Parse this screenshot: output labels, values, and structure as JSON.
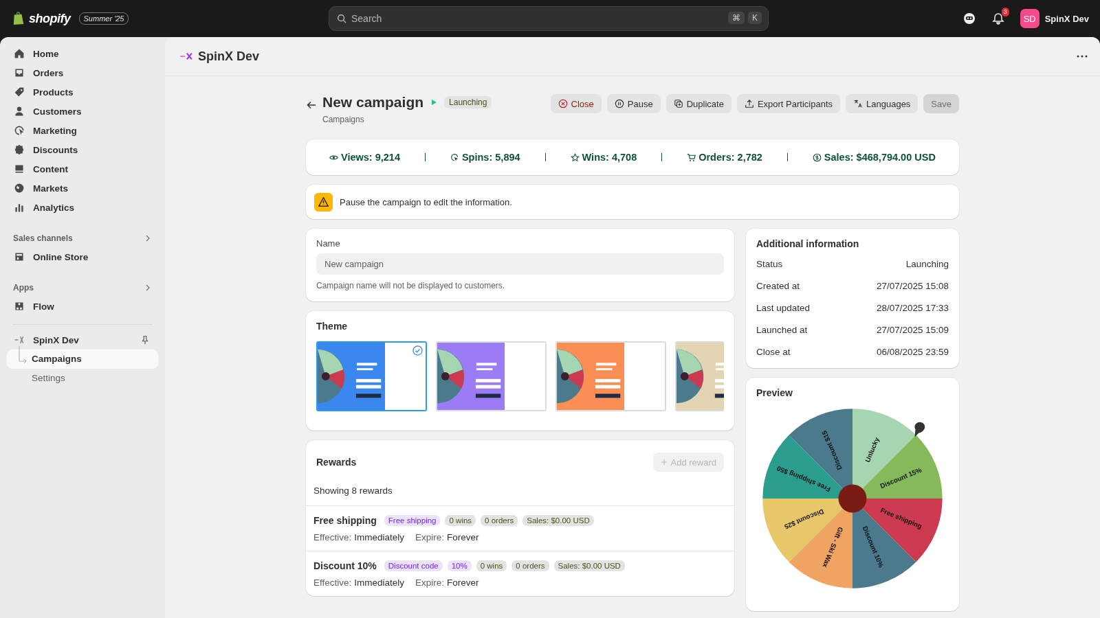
{
  "topbar": {
    "logo": "shopify",
    "edition": "Summer '25",
    "search": {
      "placeholder": "Search",
      "keys": [
        "⌘",
        "K"
      ]
    },
    "notifications": "3",
    "avatar": "SD",
    "store": "SpinX Dev"
  },
  "sidebar": {
    "items": [
      {
        "label": "Home",
        "selected": false
      },
      {
        "label": "Orders",
        "selected": false
      },
      {
        "label": "Products",
        "selected": false
      },
      {
        "label": "Customers",
        "selected": false
      },
      {
        "label": "Marketing",
        "selected": false
      },
      {
        "label": "Discounts",
        "selected": false
      },
      {
        "label": "Content",
        "selected": false
      },
      {
        "label": "Markets",
        "selected": false
      },
      {
        "label": "Analytics",
        "selected": false
      }
    ],
    "sections": [
      {
        "title": "Sales channels",
        "items": [
          {
            "label": "Online Store",
            "selected": false
          }
        ]
      },
      {
        "title": "Apps",
        "items": [
          {
            "label": "Flow",
            "selected": false
          }
        ]
      }
    ],
    "app": {
      "label": "SpinX Dev",
      "children": [
        {
          "label": "Campaigns",
          "selected": true
        },
        {
          "label": "Settings",
          "selected": false
        }
      ]
    }
  },
  "app_header": {
    "title": "SpinX Dev"
  },
  "page": {
    "title": "New campaign",
    "status": "Launching",
    "breadcrumb": "Campaigns",
    "actions": [
      {
        "label": "Close",
        "kind": "critical",
        "disabled": false
      },
      {
        "label": "Pause",
        "kind": "plain",
        "disabled": false
      },
      {
        "label": "Duplicate",
        "kind": "plain",
        "disabled": false
      },
      {
        "label": "Export Participants",
        "kind": "plain",
        "disabled": false
      },
      {
        "label": "Languages",
        "kind": "plain",
        "disabled": false
      },
      {
        "label": "Save",
        "kind": "primary",
        "disabled": true
      }
    ]
  },
  "stats": [
    "Views: 9,214",
    "Spins: 5,894",
    "Wins: 4,708",
    "Orders: 2,782",
    "Sales: $468,794.00 USD"
  ],
  "notice": "Pause the campaign to edit the information.",
  "name_card": {
    "label": "Name",
    "value": "New campaign",
    "help": "Campaign name will not be displayed to customers."
  },
  "theme": {
    "title": "Theme",
    "options": [
      {
        "color": "#3b87f0",
        "selected": true
      },
      {
        "color": "#9b7cf5",
        "selected": false
      },
      {
        "color": "#f98f55",
        "selected": false
      },
      {
        "color": "#e3d5b3",
        "selected": false
      }
    ]
  },
  "rewards": {
    "title": "Rewards",
    "add_button": {
      "label": "Add reward",
      "disabled": true
    },
    "summary": "Showing 8 rewards",
    "items": [
      {
        "name": "Free shipping",
        "tags": [
          {
            "kind": "type",
            "text": "Free shipping"
          },
          {
            "kind": "stat",
            "text": "0 wins"
          },
          {
            "kind": "stat",
            "text": "0 orders"
          },
          {
            "kind": "stat",
            "text": "Sales: $0.00 USD"
          }
        ],
        "effective_label": "Effective:",
        "effective": "Immediately",
        "expire_label": "Expire:",
        "expire": "Forever"
      },
      {
        "name": "Discount 10%",
        "tags": [
          {
            "kind": "type",
            "text": "Discount code"
          },
          {
            "kind": "type",
            "text": "10%"
          },
          {
            "kind": "stat",
            "text": "0 wins"
          },
          {
            "kind": "stat",
            "text": "0 orders"
          },
          {
            "kind": "stat",
            "text": "Sales: $0.00 USD"
          }
        ],
        "effective_label": "Effective:",
        "effective": "Immediately",
        "expire_label": "Expire:",
        "expire": "Forever"
      }
    ]
  },
  "additional_info": {
    "title": "Additional information",
    "rows": [
      {
        "label": "Status",
        "value": "Launching"
      },
      {
        "label": "Created at",
        "value": "27/07/2025 15:08"
      },
      {
        "label": "Last updated",
        "value": "28/07/2025 17:33"
      },
      {
        "label": "Launched at",
        "value": "27/07/2025 15:09"
      },
      {
        "label": "Close at",
        "value": "06/08/2025 23:59"
      }
    ]
  },
  "preview": {
    "title": "Preview",
    "segments": [
      {
        "label": "Unlucky",
        "color": "#a6d5b1"
      },
      {
        "label": "Discount 15%",
        "color": "#86b95a"
      },
      {
        "label": "Free shipping",
        "color": "#cc3a50"
      },
      {
        "label": "Discount 10%",
        "color": "#4b7a8c"
      },
      {
        "label": "Gift - Ski Wax",
        "color": "#f0a462"
      },
      {
        "label": "Discount $25",
        "color": "#e8c66a"
      },
      {
        "label": "Free shipping $50",
        "color": "#2a9d8f"
      },
      {
        "label": "Discount $15",
        "color": "#4b7a8c"
      }
    ]
  }
}
